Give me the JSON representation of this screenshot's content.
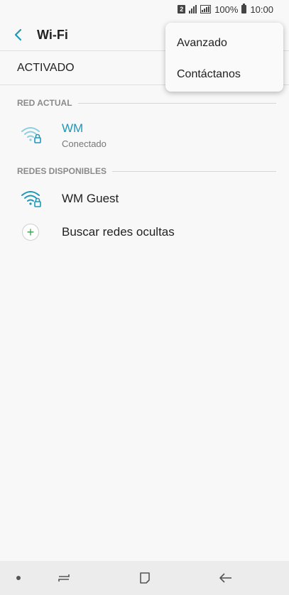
{
  "status_bar": {
    "sim_slot": "2",
    "battery_percent": "100%",
    "time": "10:00"
  },
  "header": {
    "title": "Wi-Fi",
    "back_icon": "back-arrow-icon"
  },
  "master_switch": {
    "label": "ACTIVADO"
  },
  "current_network": {
    "section_label": "RED ACTUAL",
    "name": "WM",
    "status": "Conectado",
    "icon": "wifi-locked-icon",
    "accent_color": "#1e98b7"
  },
  "available_networks": {
    "section_label": "REDES DISPONIBLES",
    "items": [
      {
        "name": "WM Guest",
        "icon": "wifi-locked-icon"
      }
    ],
    "search_hidden": {
      "label": "Buscar redes ocultas",
      "icon": "plus-icon"
    }
  },
  "overflow_menu": {
    "items": [
      {
        "label": "Avanzado"
      },
      {
        "label": "Contáctanos"
      }
    ]
  },
  "nav_bar": {
    "icons": [
      "dot-icon",
      "recents-icon",
      "home-icon",
      "back-icon"
    ]
  }
}
